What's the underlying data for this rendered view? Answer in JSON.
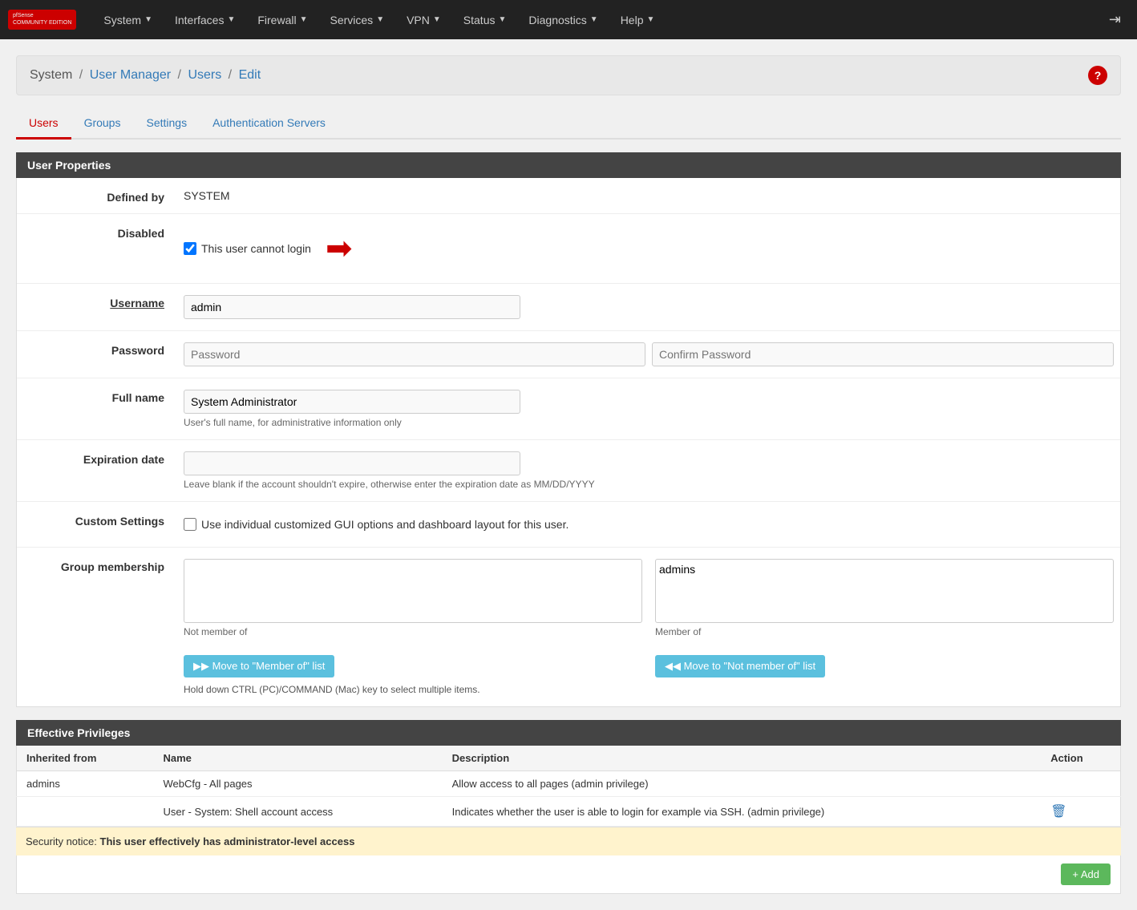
{
  "navbar": {
    "brand": "pfSense",
    "brand_sub": "COMMUNITY EDITION",
    "items": [
      {
        "label": "System",
        "id": "system"
      },
      {
        "label": "Interfaces",
        "id": "interfaces"
      },
      {
        "label": "Firewall",
        "id": "firewall"
      },
      {
        "label": "Services",
        "id": "services"
      },
      {
        "label": "VPN",
        "id": "vpn"
      },
      {
        "label": "Status",
        "id": "status"
      },
      {
        "label": "Diagnostics",
        "id": "diagnostics"
      },
      {
        "label": "Help",
        "id": "help"
      }
    ]
  },
  "breadcrumb": {
    "parts": [
      {
        "label": "System",
        "link": true
      },
      {
        "label": "User Manager",
        "link": true
      },
      {
        "label": "Users",
        "link": true
      },
      {
        "label": "Edit",
        "link": true
      }
    ],
    "help_label": "?"
  },
  "tabs": [
    {
      "label": "Users",
      "id": "users",
      "active": true
    },
    {
      "label": "Groups",
      "id": "groups",
      "active": false
    },
    {
      "label": "Settings",
      "id": "settings",
      "active": false
    },
    {
      "label": "Authentication Servers",
      "id": "auth-servers",
      "active": false
    }
  ],
  "user_properties": {
    "section_title": "User Properties",
    "fields": {
      "defined_by": {
        "label": "Defined by",
        "value": "SYSTEM"
      },
      "disabled": {
        "label": "Disabled",
        "checkbox_checked": true,
        "checkbox_label": "This user cannot login"
      },
      "username": {
        "label": "Username",
        "value": "admin",
        "placeholder": ""
      },
      "password": {
        "label": "Password",
        "placeholder": "Password",
        "confirm_placeholder": "Confirm Password"
      },
      "full_name": {
        "label": "Full name",
        "value": "System Administrator",
        "hint": "User's full name, for administrative information only"
      },
      "expiration_date": {
        "label": "Expiration date",
        "value": "",
        "hint": "Leave blank if the account shouldn't expire, otherwise enter the expiration date as MM/DD/YYYY"
      },
      "custom_settings": {
        "label": "Custom Settings",
        "checkbox_checked": false,
        "checkbox_label": "Use individual customized GUI options and dashboard layout for this user."
      },
      "group_membership": {
        "label": "Group membership",
        "not_member_label": "Not member of",
        "member_label": "Member of",
        "member_of": [
          "admins"
        ],
        "not_member_of": [],
        "move_to_member_label": "▶▶  Move to \"Member of\" list",
        "move_to_not_member_label": "◀◀  Move to \"Not member of\" list",
        "hint": "Hold down CTRL (PC)/COMMAND (Mac) key to select multiple items."
      }
    }
  },
  "effective_privileges": {
    "section_title": "Effective Privileges",
    "columns": {
      "inherited_from": "Inherited from",
      "name": "Name",
      "description": "Description",
      "action": "Action"
    },
    "rows": [
      {
        "inherited_from": "admins",
        "name": "WebCfg - All pages",
        "description": "Allow access to all pages (admin privilege)",
        "deletable": false
      },
      {
        "inherited_from": "",
        "name": "User - System: Shell account access",
        "description": "Indicates whether the user is able to login for example via SSH. (admin privilege)",
        "deletable": true
      }
    ],
    "security_notice": "Security notice:",
    "security_notice_bold": "This user effectively has administrator-level access"
  },
  "add_button_label": "+ Add"
}
